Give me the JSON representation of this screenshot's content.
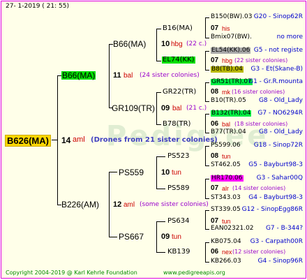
{
  "header": {
    "date": "27-  1-2019 (  21:  55)"
  },
  "footer": {
    "copyright": "Copyright 2004-2019 @ Karl Kehrle Foundation",
    "url": "www.pedigreeapis.org"
  },
  "colors": {
    "frame_border": "#e000e0",
    "background": "#ffffe9",
    "gold": "#ffd700",
    "green": "#00e000",
    "lightgreen": "#00ee44",
    "grey": "#a9a9a9",
    "olive": "#b8b800",
    "magenta": "#ff00ff",
    "gen_red": "#cc0000",
    "count_purple": "#9900cc",
    "region_blue": "#0000cc"
  },
  "pedigree": {
    "root": {
      "name": "B626(MA)",
      "year": "14",
      "gen": "aml",
      "note": "(Drones from 21 sister colonies)"
    },
    "sire": {
      "name": "B66(MA)",
      "year": "11",
      "gen": "bal",
      "count": "(24 sister colonies)"
    },
    "dam": {
      "name": "B226(AM)",
      "year": "12",
      "gen": "aml",
      "count": "(some sister colonies)"
    },
    "l3": {
      "b66": {
        "name": "B66(MA)",
        "year": "10",
        "gen": "hbg",
        "count": "(22 c.)"
      },
      "gr109": {
        "name": "GR109(TR)",
        "year": "09",
        "gen": "bal",
        "count": "(21 c.)"
      },
      "ps559": {
        "name": "PS559",
        "year": "10",
        "gen": "tun"
      },
      "ps667": {
        "name": "PS667",
        "year": "09",
        "gen": "tun"
      }
    },
    "l4": {
      "b16": {
        "name": "B16(MA)",
        "year": "07",
        "gen": "his"
      },
      "el74": {
        "name": "EL74(KK)",
        "year": "07",
        "gen": "hbg",
        "count": "(22 sister colonies)"
      },
      "gr22": {
        "name": "GR22(TR)",
        "year": "08",
        "gen": "mk",
        "count": "(16 sister colonies)"
      },
      "b78": {
        "name": "B78(TR)",
        "year": "06",
        "gen": "bal",
        "count": "(18 sister colonies)"
      },
      "ps523": {
        "name": "PS523",
        "year": "08",
        "gen": "tun"
      },
      "ps589": {
        "name": "PS589",
        "year": "07",
        "gen": "alr",
        "count": "(14 sister colonies)"
      },
      "ps634": {
        "name": "PS634",
        "year": "07",
        "gen": "tun"
      },
      "kb139": {
        "name": "KB139",
        "year": "06",
        "gen": "nex",
        "count": "(12 sister colonies)"
      }
    },
    "l5": [
      {
        "name": "B150(BW).03",
        "region": "G20 - Sinop62R"
      },
      {
        "name": "Bmix07(BW).",
        "region": "no more"
      },
      {
        "name": "EL54(KK).06",
        "region": "G5 - not registe"
      },
      {
        "name": "B8(TB).04",
        "region": "G3 - Et(Skane-B)"
      },
      {
        "name": "GR51(TR).07",
        "region": "G1 - Gr.R.mounta"
      },
      {
        "name": "B10(TR).05",
        "region": "G8 - Old_Lady"
      },
      {
        "name": "B132(TR).04",
        "region": "G7 - NO6294R"
      },
      {
        "name": "B77(TR).04",
        "region": "G8 - Old_Lady"
      },
      {
        "name": "PS599.06",
        "region": "G18 - Sinop72R"
      },
      {
        "name": "ST462.05",
        "region": "G5 - Bayburt98-3"
      },
      {
        "name": "HR170.06",
        "region": "G3 - Sahar00Q"
      },
      {
        "name": "ST343.03",
        "region": "G4 - Bayburt98-3"
      },
      {
        "name": "ST339.05",
        "region": "G12 - SinopEgg86R"
      },
      {
        "name": "EAN02321.02",
        "region": "G7 - B-344?"
      },
      {
        "name": "KB075.04",
        "region": "G3 - Carpath00R"
      },
      {
        "name": "KB266.03",
        "region": "G4 - Sinop96R"
      }
    ],
    "watermark": "Pedigree"
  }
}
